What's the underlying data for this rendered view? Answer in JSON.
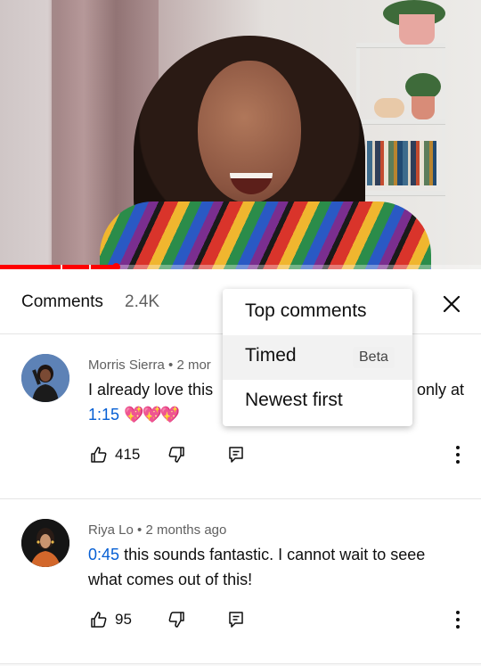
{
  "video": {
    "progress": 0.24,
    "accent_color": "#ff0000"
  },
  "comments_panel": {
    "title": "Comments",
    "count": "2.4K",
    "close_icon": "close-icon"
  },
  "sort_menu": {
    "items": [
      {
        "label": "Top comments"
      },
      {
        "label": "Timed",
        "badge": "Beta"
      },
      {
        "label": "Newest first"
      }
    ]
  },
  "comments": [
    {
      "author": "Morris Sierra",
      "time": "2 mor",
      "text_start": "I already love this",
      "text_end": "only at",
      "timestamp": "1:15",
      "emoji": "💖💖💖",
      "likes": "415"
    },
    {
      "author": "Riya Lo",
      "time": "2 months ago",
      "timestamp": "0:45",
      "text": "this sounds fantastic. I cannot wait to seee what comes out of this!",
      "likes": "95"
    }
  ]
}
